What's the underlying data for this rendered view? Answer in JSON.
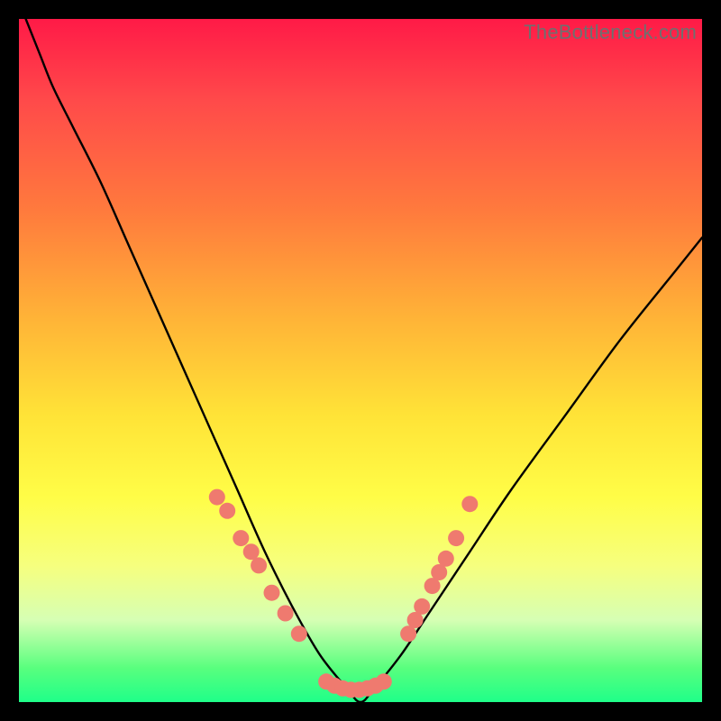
{
  "watermark": "TheBottleneck.com",
  "chart_data": {
    "type": "line",
    "title": "",
    "xlabel": "",
    "ylabel": "",
    "xlim": [
      0,
      100
    ],
    "ylim": [
      0,
      100
    ],
    "series": [
      {
        "name": "bottleneck-curve",
        "x": [
          1,
          3,
          5,
          8,
          12,
          16,
          20,
          24,
          28,
          32,
          36,
          40,
          44,
          48,
          50,
          52,
          56,
          60,
          66,
          72,
          80,
          88,
          96,
          100
        ],
        "values": [
          100,
          95,
          90,
          84,
          76,
          67,
          58,
          49,
          40,
          31,
          22,
          14,
          7,
          2,
          0,
          2,
          7,
          13,
          22,
          31,
          42,
          53,
          63,
          68
        ]
      }
    ],
    "markers": [
      {
        "name": "left-dot-1",
        "x": 29.0,
        "y": 30
      },
      {
        "name": "left-dot-2",
        "x": 30.5,
        "y": 28
      },
      {
        "name": "left-dot-3",
        "x": 32.5,
        "y": 24
      },
      {
        "name": "left-dot-4",
        "x": 34.0,
        "y": 22
      },
      {
        "name": "left-dot-5",
        "x": 35.1,
        "y": 20
      },
      {
        "name": "left-dot-6",
        "x": 37.0,
        "y": 16
      },
      {
        "name": "left-dot-7",
        "x": 39.0,
        "y": 13
      },
      {
        "name": "left-dot-8",
        "x": 41.0,
        "y": 10
      },
      {
        "name": "flat-dot-1",
        "x": 45.0,
        "y": 3.0
      },
      {
        "name": "flat-dot-2",
        "x": 46.2,
        "y": 2.4
      },
      {
        "name": "flat-dot-3",
        "x": 47.4,
        "y": 2.0
      },
      {
        "name": "flat-dot-4",
        "x": 48.6,
        "y": 1.8
      },
      {
        "name": "flat-dot-5",
        "x": 49.8,
        "y": 1.8
      },
      {
        "name": "flat-dot-6",
        "x": 51.0,
        "y": 2.0
      },
      {
        "name": "flat-dot-7",
        "x": 52.2,
        "y": 2.4
      },
      {
        "name": "flat-dot-8",
        "x": 53.4,
        "y": 3.0
      },
      {
        "name": "right-dot-1",
        "x": 57.0,
        "y": 10
      },
      {
        "name": "right-dot-2",
        "x": 58.0,
        "y": 12
      },
      {
        "name": "right-dot-3",
        "x": 59.0,
        "y": 14
      },
      {
        "name": "right-dot-4",
        "x": 60.5,
        "y": 17
      },
      {
        "name": "right-dot-5",
        "x": 61.5,
        "y": 19
      },
      {
        "name": "right-dot-6",
        "x": 62.5,
        "y": 21
      },
      {
        "name": "right-dot-7",
        "x": 64.0,
        "y": 24
      },
      {
        "name": "right-dot-8",
        "x": 66.0,
        "y": 29
      }
    ],
    "marker_color": "#ef7a6f",
    "marker_radius_px": 9
  }
}
